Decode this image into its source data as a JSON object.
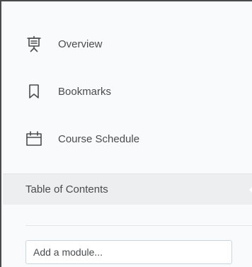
{
  "sidebar": {
    "items": [
      {
        "label": "Overview",
        "icon": "presentation-board-icon"
      },
      {
        "label": "Bookmarks",
        "icon": "bookmark-icon"
      },
      {
        "label": "Course Schedule",
        "icon": "calendar-icon"
      }
    ]
  },
  "toc": {
    "title": "Table of Contents"
  },
  "module_input": {
    "placeholder": "Add a module...",
    "value": ""
  },
  "colors": {
    "text": "#494c4e",
    "background": "#f9fafb",
    "toc_header_bg": "#eceef0",
    "input_border": "#cdd5dc"
  }
}
